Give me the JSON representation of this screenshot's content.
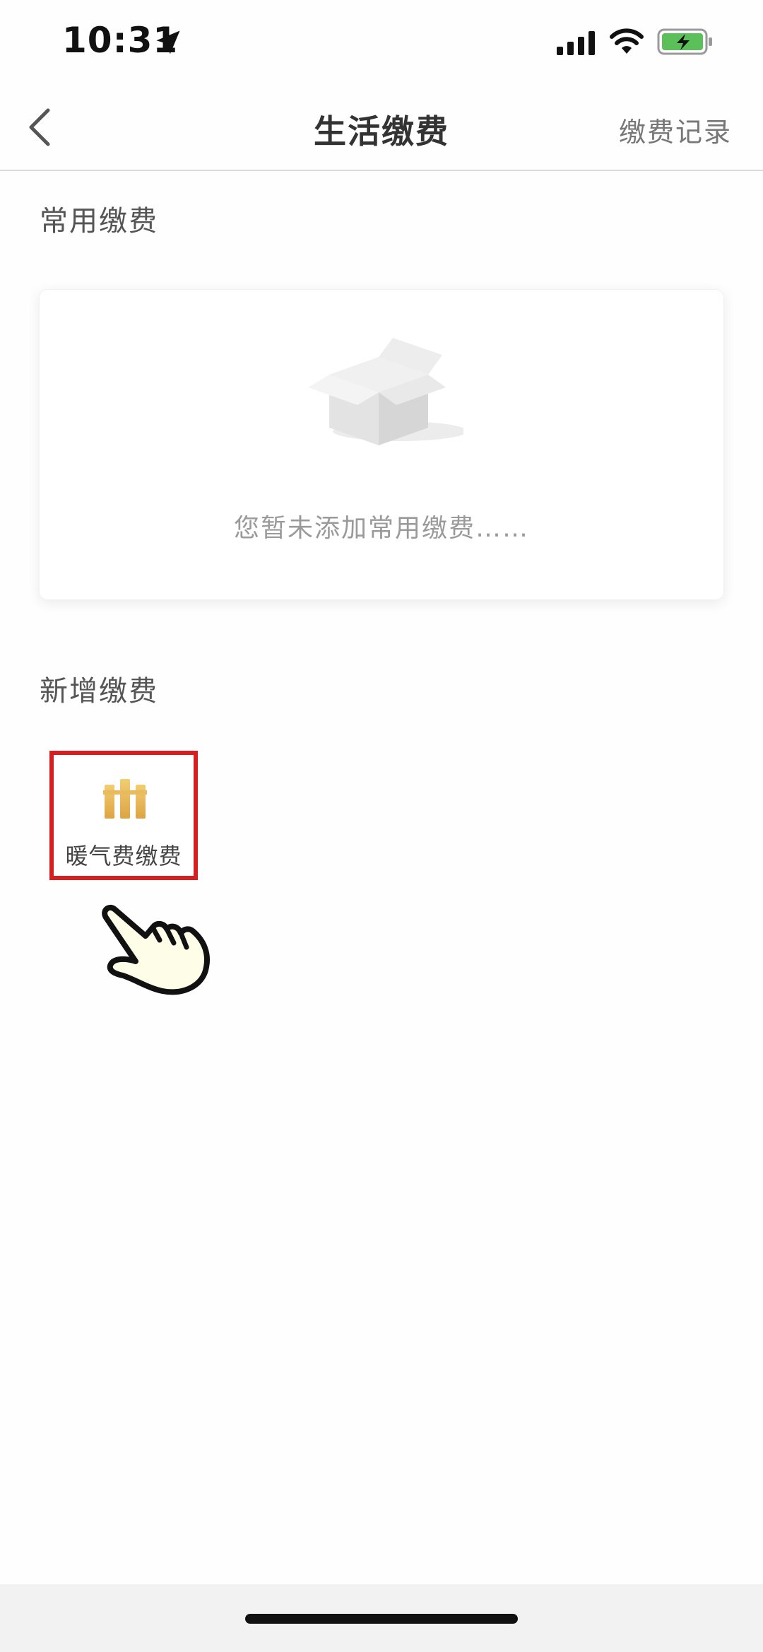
{
  "status_bar": {
    "time": "10:31"
  },
  "nav": {
    "title": "生活缴费",
    "right_link": "缴费记录"
  },
  "common_section": {
    "title": "常用缴费",
    "empty_message": "您暂未添加常用缴费……"
  },
  "new_section": {
    "title": "新增缴费",
    "items": [
      {
        "label": "暖气费缴费",
        "icon": "radiator-icon"
      }
    ]
  },
  "colors": {
    "highlight": "#d42020",
    "icon_gold": "#e3b04b",
    "title": "#333333",
    "muted": "#9a9a9a"
  }
}
